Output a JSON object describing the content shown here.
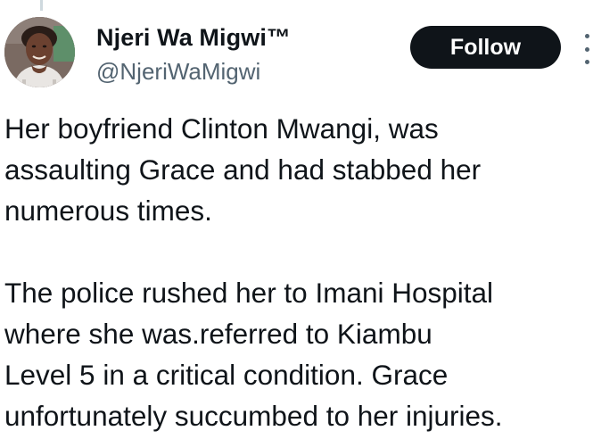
{
  "tweet": {
    "author": {
      "display_name": "Njeri Wa Migwi™",
      "handle": "@NjeriWaMigwi",
      "avatar_icon": "profile-photo"
    },
    "follow_label": "Follow",
    "more_icon": "more-horizontal-icon",
    "text_lines": [
      "Her boyfriend Clinton Mwangi, was",
      "assaulting Grace and had stabbed her",
      "numerous times.",
      "",
      "The police rushed her to Imani Hospital",
      "where she was.referred to Kiambu",
      "Level 5 in a critical condition. Grace",
      "unfortunately succumbed to her injuries."
    ]
  },
  "colors": {
    "text": "#0f1419",
    "secondary": "#536471",
    "button_bg": "#0f1419",
    "button_text": "#ffffff",
    "thread_line": "#cfd9de"
  }
}
